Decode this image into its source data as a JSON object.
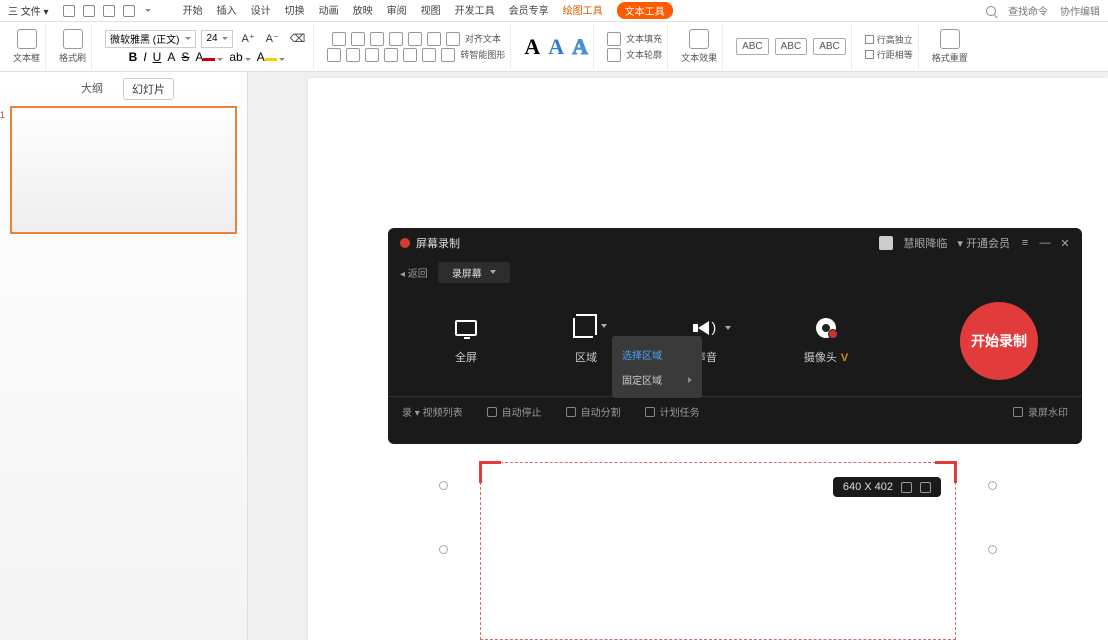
{
  "menu": {
    "file": "三 文件 ▾",
    "tabs": [
      "开始",
      "插入",
      "设计",
      "切换",
      "动画",
      "放映",
      "审阅",
      "视图",
      "开发工具",
      "会员专享"
    ],
    "accent_tab": "绘图工具",
    "pill_tab": "文本工具",
    "search_placeholder": "查找命令",
    "coop": "协作编辑"
  },
  "ribbon": {
    "group1_label": "文本框",
    "group2_label": "格式刷",
    "font_name": "微软雅黑 (正文)",
    "font_size": "24",
    "bold": "B",
    "italic": "I",
    "underline": "U",
    "aa1": "A",
    "strike": "S",
    "aa2": "A",
    "align_label": "对齐文本",
    "convert_label": "转智能图形",
    "text_fill": "文本填充",
    "text_outline": "文本轮廓",
    "text_effect": "文本效果",
    "abc": "ABC",
    "row_height": "行高独立",
    "line_spacing": "行距相等",
    "reset": "格式重置"
  },
  "sidebar": {
    "tab_outline": "大纲",
    "tab_slides": "幻灯片",
    "slide_num": "1"
  },
  "recorder": {
    "title": "屏幕录制",
    "user": "慧眼降临",
    "membership": "▾ 开通会员",
    "back": "◂ 返回",
    "dropdown": "录屏幕",
    "opt_fullscreen": "全屏",
    "opt_region": "区域",
    "opt_sound": "声音",
    "opt_camera": "摄像头",
    "v": "V",
    "menu_select": "选择区域",
    "menu_fixed": "固定区域",
    "record_btn": "开始录制",
    "footer_list": "录 ▾ 视频列表",
    "footer_auto_stop": "自动停止",
    "footer_auto_split": "自动分割",
    "footer_schedule": "计划任务",
    "footer_watermark": "录屏水印"
  },
  "crop": {
    "dimensions": "640 X 402"
  }
}
